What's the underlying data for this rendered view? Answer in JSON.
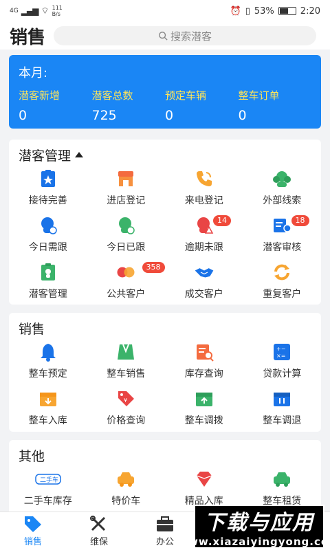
{
  "status_bar": {
    "network": "4G",
    "speed": "111",
    "speed_unit": "B/s",
    "battery_percent": "53%",
    "time": "2:20"
  },
  "header": {
    "title": "销售",
    "search_placeholder": "搜索潜客"
  },
  "month": {
    "title": "本月:",
    "stats": [
      {
        "label": "潜客新增",
        "value": "0"
      },
      {
        "label": "潜客总数",
        "value": "725"
      },
      {
        "label": "预定车辆",
        "value": "0"
      },
      {
        "label": "整车订单",
        "value": "0"
      }
    ]
  },
  "lead_section": {
    "title": "潜客管理",
    "items": [
      {
        "label": "接待完善",
        "icon": "reception-icon"
      },
      {
        "label": "进店登记",
        "icon": "store-icon"
      },
      {
        "label": "来电登记",
        "icon": "phone-icon"
      },
      {
        "label": "外部线索",
        "icon": "external-clue-icon"
      },
      {
        "label": "今日需跟",
        "icon": "today-follow-icon"
      },
      {
        "label": "今日已跟",
        "icon": "today-followed-icon"
      },
      {
        "label": "逾期未跟",
        "icon": "overdue-icon",
        "badge": "14"
      },
      {
        "label": "潜客审核",
        "icon": "review-icon",
        "badge": "18"
      },
      {
        "label": "潜客管理",
        "icon": "lead-manage-icon"
      },
      {
        "label": "公共客户",
        "icon": "public-customer-icon",
        "badge": "358"
      },
      {
        "label": "成交客户",
        "icon": "handshake-icon"
      },
      {
        "label": "重复客户",
        "icon": "repeat-icon"
      }
    ]
  },
  "sales_section": {
    "title": "销售",
    "items": [
      {
        "label": "整车预定",
        "icon": "bell-icon"
      },
      {
        "label": "整车销售",
        "icon": "sales-icon"
      },
      {
        "label": "库存查询",
        "icon": "inventory-search-icon"
      },
      {
        "label": "贷款计算",
        "icon": "calculator-icon"
      },
      {
        "label": "整车入库",
        "icon": "stock-in-icon"
      },
      {
        "label": "价格查询",
        "icon": "price-tag-icon"
      },
      {
        "label": "整车调拨",
        "icon": "transfer-icon"
      },
      {
        "label": "整车调退",
        "icon": "return-icon"
      }
    ]
  },
  "other_section": {
    "title": "其他",
    "items": [
      {
        "label": "二手车库存",
        "icon": "used-car-icon",
        "icon_text": "二手车"
      },
      {
        "label": "特价车",
        "icon": "special-car-icon"
      },
      {
        "label": "精品入库",
        "icon": "boutique-icon"
      },
      {
        "label": "整车租赁",
        "icon": "car-rental-icon"
      }
    ]
  },
  "tabbar": [
    {
      "label": "销售",
      "icon": "sales-tab-icon",
      "active": true
    },
    {
      "label": "维保",
      "icon": "tools-icon",
      "active": false
    },
    {
      "label": "办公",
      "icon": "briefcase-icon",
      "active": false
    }
  ],
  "watermark": {
    "main": "下载与应用",
    "sub": "www.xiazaiyingyong.com"
  },
  "colors": {
    "accent": "#1a86f5",
    "stat_label": "#ffe55a",
    "badge": "#f04a3a"
  }
}
